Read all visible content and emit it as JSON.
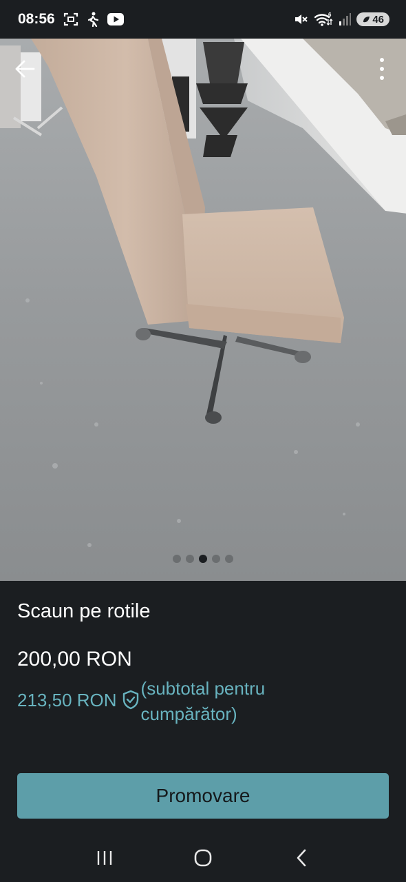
{
  "status_bar": {
    "time": "08:56",
    "battery": "46",
    "left_icons": [
      "screenshot-icon",
      "walking-icon",
      "youtube-icon"
    ],
    "right_icons": [
      "mute-icon",
      "wifi-icon",
      "signal-icon",
      "battery-icon"
    ]
  },
  "gallery": {
    "image_count": 5,
    "active_index": 2,
    "icons": [
      "back-arrow-icon",
      "more-vert-icon"
    ]
  },
  "listing": {
    "title": "Scaun pe rotile",
    "price": "200,00 RON",
    "buyer_price": "213,50 RON",
    "buyer_note": "(subtotal pentru cumpărător)"
  },
  "actions": {
    "promote_label": "Promovare"
  },
  "nav_bar": {
    "icons": [
      "recent-apps-icon",
      "home-icon",
      "back-icon"
    ]
  },
  "colors": {
    "background": "#1b1e21",
    "accent": "#5d9ea9",
    "buyer_text": "#68b3bf"
  }
}
